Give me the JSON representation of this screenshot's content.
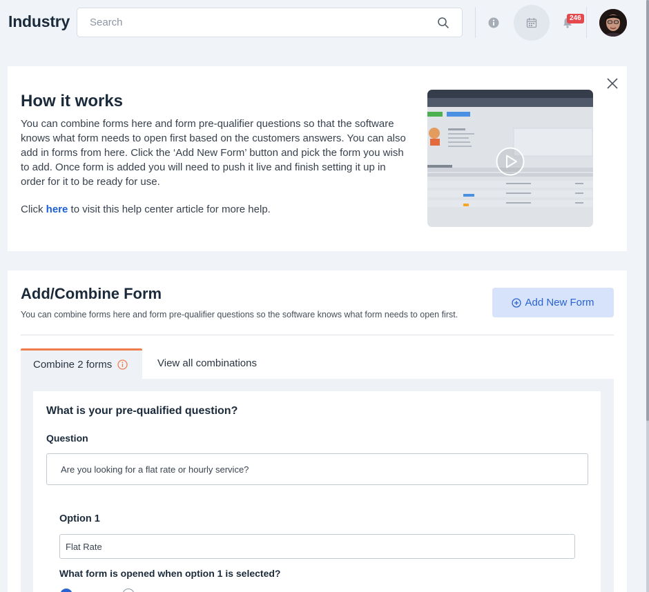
{
  "header": {
    "app_title": "Industry",
    "search_placeholder": "Search",
    "notification_count": "246"
  },
  "how_it_works": {
    "title": "How it works",
    "description": "You can combine forms here and form pre-qualifier questions so that the software knows what form needs to open first based on the customers answers. You can also add in forms from here. Click the ‘Add New Form’ button and pick the form you wish to add. Once form is added you will need to push it live and finish setting it up in order for it to be ready for use.",
    "help_prefix": "Click",
    "help_link": "here",
    "help_suffix": "to visit this help center article for more help."
  },
  "combine_form": {
    "title": "Add/Combine Form",
    "subtitle": "You can combine forms here and form pre-qualifier questions so the software knows what form needs to open first.",
    "add_button_label": "Add New Form",
    "tabs": [
      {
        "label": "Combine 2 forms",
        "active": true
      },
      {
        "label": "View all combinations",
        "active": false
      }
    ],
    "question_title": "What is your pre-qualified question?",
    "question_label": "Question",
    "question_value": "Are you looking for a flat rate or hourly service?",
    "option1_label": "Option 1",
    "option1_value": "Flat Rate",
    "option1_form_question": "What form is opened when option 1 is selected?"
  },
  "colors": {
    "accent": "#2a63cf",
    "tab_indicator": "#ef7d4c",
    "badge": "#e5484d"
  }
}
